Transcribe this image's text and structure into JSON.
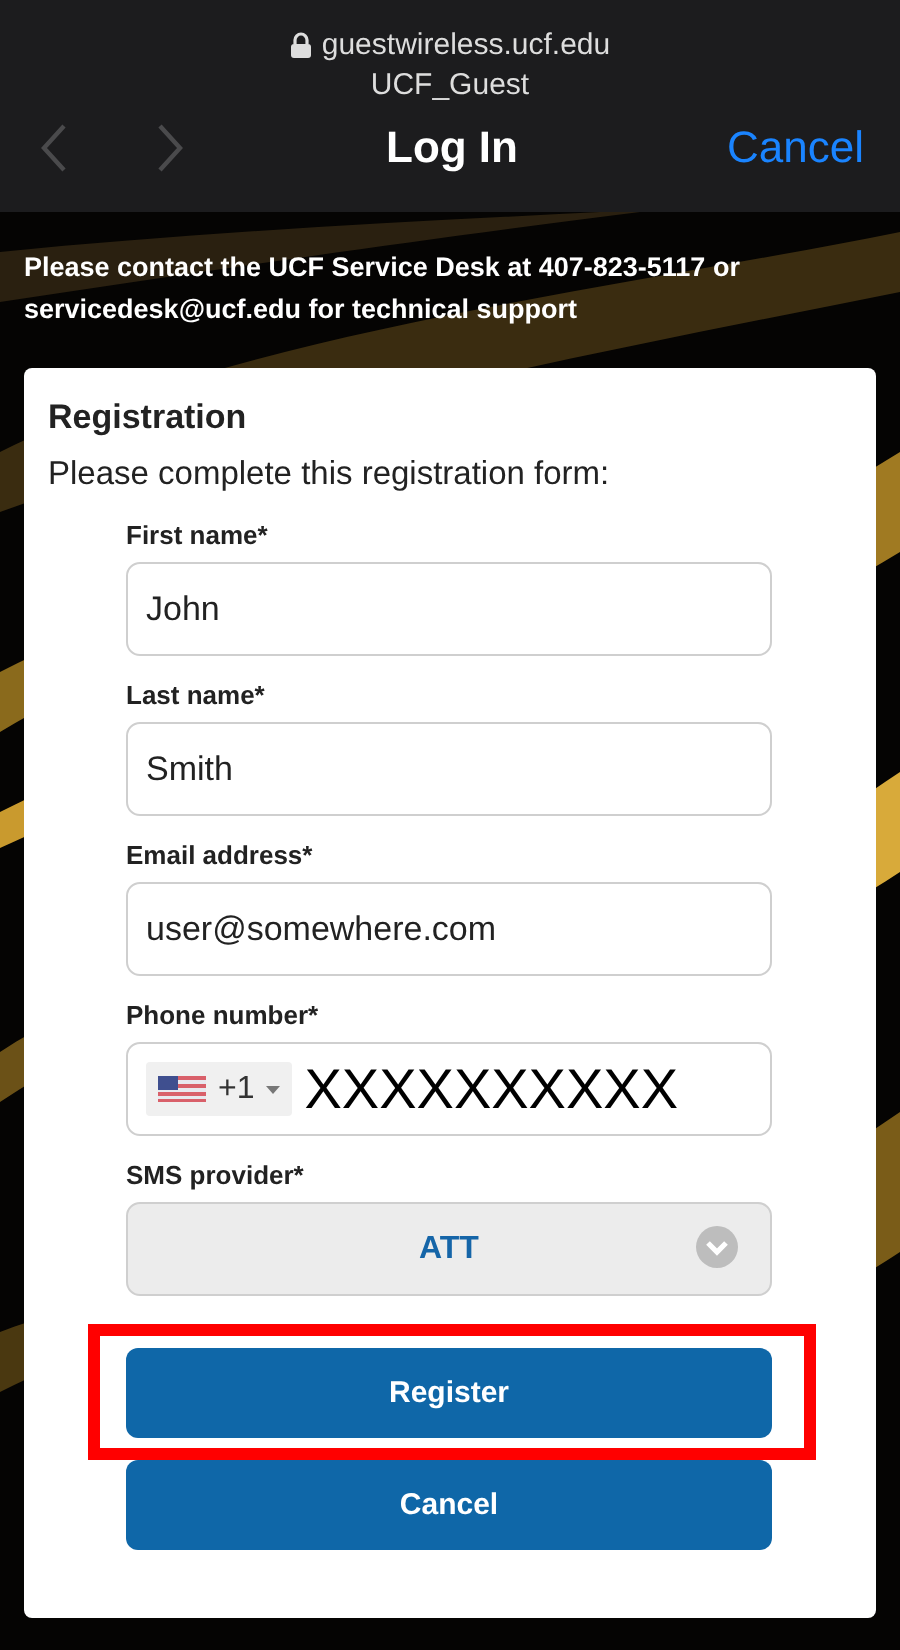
{
  "browser_bar": {
    "domain": "guestwireless.ucf.edu",
    "network": "UCF_Guest",
    "title": "Log In",
    "back_disabled": true,
    "forward_disabled": true,
    "cancel": "Cancel"
  },
  "notice": "Please contact the UCF Service Desk at 407-823-5117 or servicedesk@ucf.edu for technical support",
  "form": {
    "title": "Registration",
    "subtitle": "Please complete this registration form:",
    "fields": [
      {
        "kind": "text",
        "label": "First name*",
        "value": "John"
      },
      {
        "kind": "text",
        "label": "Last name*",
        "value": "Smith"
      },
      {
        "kind": "text",
        "label": "Email address*",
        "value": "user@somewhere.com"
      },
      {
        "kind": "phone",
        "label": "Phone number*",
        "country_code": "+1",
        "value": "XXXXXXXXXX"
      },
      {
        "kind": "select",
        "label": "SMS provider*",
        "value": "ATT"
      }
    ],
    "buttons": [
      {
        "label": "Register",
        "highlighted": true
      },
      {
        "label": "Cancel",
        "highlighted": false
      }
    ]
  }
}
